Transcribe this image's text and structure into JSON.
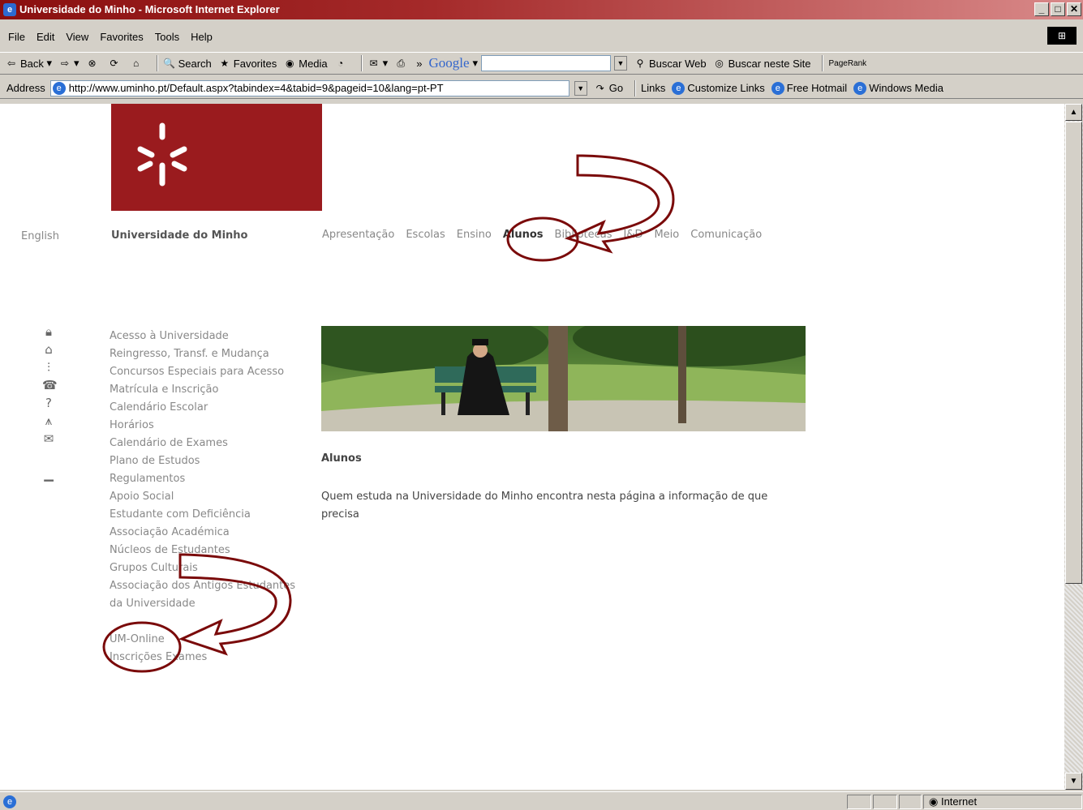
{
  "window": {
    "title": "Universidade do Minho - Microsoft Internet Explorer"
  },
  "menu": [
    "File",
    "Edit",
    "View",
    "Favorites",
    "Tools",
    "Help"
  ],
  "toolbar": {
    "back": "Back",
    "search": "Search",
    "favorites": "Favorites",
    "media": "Media",
    "google": "Google",
    "buscar_web": "Buscar Web",
    "buscar_site": "Buscar neste Site",
    "pagerank": "PageRank"
  },
  "address": {
    "label": "Address",
    "url": "http://www.uminho.pt/Default.aspx?tabindex=4&tabid=9&pageid=10&lang=pt-PT",
    "go": "Go",
    "links_label": "Links",
    "links": [
      "Customize Links",
      "Free Hotmail",
      "Windows Media"
    ]
  },
  "page": {
    "english": "English",
    "university": "Universidade do Minho",
    "top_nav": [
      "Apresentação",
      "Escolas",
      "Ensino",
      "Alunos",
      "Bibliotecas",
      "I&D",
      "Meio",
      "Comunicação"
    ],
    "active_nav": "Alunos",
    "side_icons": [
      "lock-icon",
      "home-icon",
      "sitemap-icon",
      "phone-icon",
      "help-icon",
      "road-icon",
      "mail-icon",
      "print-icon"
    ],
    "side_menu": [
      "Acesso à Universidade",
      "Reingresso, Transf. e Mudança",
      "Concursos Especiais para Acesso",
      "Matrícula e Inscrição",
      "Calendário Escolar",
      "Horários",
      "Calendário de Exames",
      "Plano de Estudos",
      "Regulamentos",
      "Apoio Social",
      "Estudante com Deficiência",
      "Associação Académica",
      "Núcleos de Estudantes",
      "Grupos Culturais",
      "Associação dos Antigos Estudantes",
      "da Universidade"
    ],
    "side_menu_extra": [
      "UM-Online",
      "Inscrições Exames"
    ],
    "heading": "Alunos",
    "description": "Quem estuda na Universidade do Minho encontra nesta página a informação de que precisa"
  },
  "status": {
    "zone": "Internet"
  },
  "colors": {
    "brand": "#9a1b1e",
    "annotation": "#7a0a0a"
  }
}
